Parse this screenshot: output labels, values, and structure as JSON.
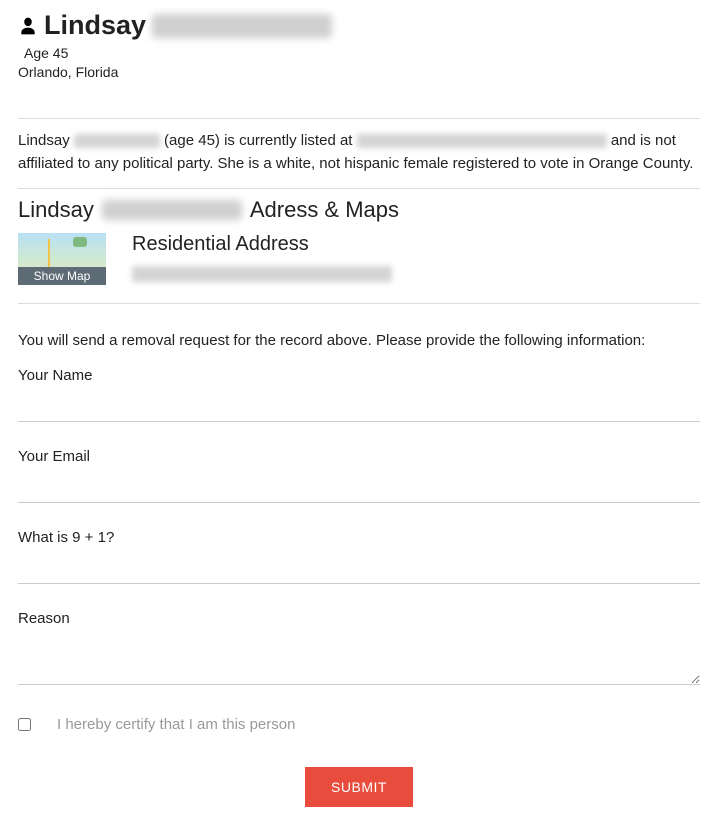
{
  "header": {
    "first_name": "Lindsay",
    "age_line": "Age 45",
    "location_line": "Orlando, Florida"
  },
  "summary": {
    "prefix": "Lindsay",
    "mid": "(age 45) is currently listed at",
    "suffix": "and is not affiliated to any political party. She is a white, not hispanic female registered to vote in Orange County."
  },
  "maps_section": {
    "title_prefix": "Lindsay",
    "title_suffix": "Adress & Maps",
    "show_map_label": "Show Map",
    "residential_label": "Residential Address"
  },
  "form": {
    "intro": "You will send a removal request for the record above. Please provide the following information:",
    "name_label": "Your Name",
    "email_label": "Your Email",
    "captcha_label": "What is 9 + 1?",
    "reason_label": "Reason",
    "certify_label": "I hereby certify that I am this person",
    "submit_label": "SUBMIT"
  }
}
